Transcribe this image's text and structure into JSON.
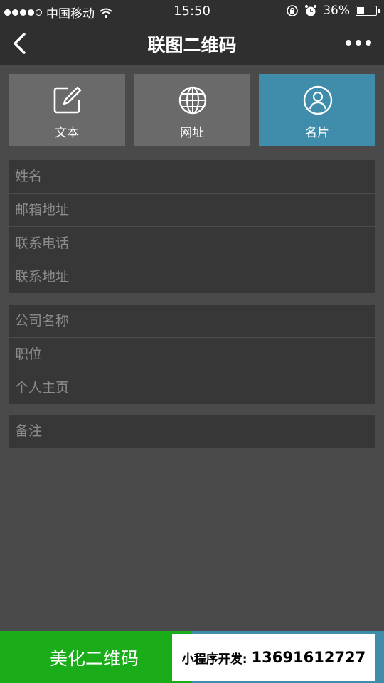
{
  "status_bar": {
    "carrier": "中国移动",
    "time": "15:50",
    "battery_percent": "36%",
    "battery_level": 0.36,
    "icons": [
      "signal-dots-icon",
      "wifi-icon",
      "rotation-lock-icon",
      "alarm-icon",
      "battery-icon"
    ]
  },
  "navbar": {
    "title": "联图二维码",
    "back_icon": "chevron-left-icon",
    "more_icon": "more-dots-icon"
  },
  "tabs": [
    {
      "label": "文本",
      "icon": "edit-icon",
      "active": false
    },
    {
      "label": "网址",
      "icon": "globe-icon",
      "active": false
    },
    {
      "label": "名片",
      "icon": "person-icon",
      "active": true
    }
  ],
  "form": {
    "group1": [
      "姓名",
      "邮箱地址",
      "联系电话",
      "联系地址"
    ],
    "group2": [
      "公司名称",
      "职位",
      "个人主页"
    ],
    "group3": [
      "备注"
    ]
  },
  "bottom": {
    "beautify_label": "美化二维码",
    "ad_label": "小程序开发:",
    "ad_phone": "13691612727"
  },
  "colors": {
    "accent_blue": "#3f8cab",
    "green": "#1aad19",
    "bar_bg": "#2f2f2f",
    "page_bg": "#4a4a4a"
  }
}
